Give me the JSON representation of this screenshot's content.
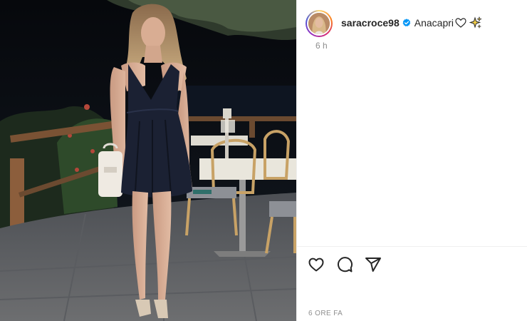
{
  "post": {
    "image_alt": "",
    "author": {
      "username": "saracroce98",
      "verified": true,
      "avatar_icon": "profile-avatar"
    },
    "caption": {
      "text": "Anacapri",
      "emojis": [
        "white-heart",
        "sparkles"
      ]
    },
    "relative_time": "6 h",
    "timestamp_caps": "6 ORE FA"
  },
  "actions": {
    "like_icon": "heart-icon",
    "comment_icon": "comment-icon",
    "share_icon": "share-icon"
  },
  "colors": {
    "verified_blue": "#0095f6",
    "text_primary": "#262626",
    "text_secondary": "#8e8e8e",
    "divider": "#efefef"
  }
}
